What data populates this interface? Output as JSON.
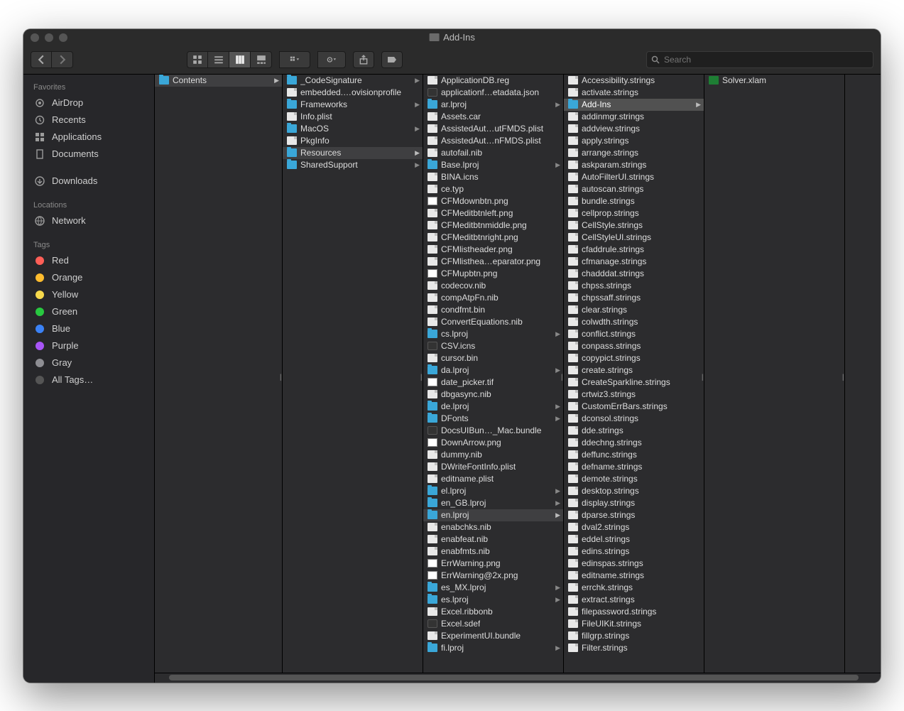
{
  "window": {
    "title": "Add-Ins"
  },
  "search": {
    "placeholder": "Search"
  },
  "sidebar": {
    "sections": [
      {
        "title": "Favorites",
        "items": [
          {
            "icon": "airdrop",
            "label": "AirDrop"
          },
          {
            "icon": "recents",
            "label": "Recents"
          },
          {
            "icon": "apps",
            "label": "Applications"
          },
          {
            "icon": "docs",
            "label": "Documents"
          },
          {
            "icon": "downloads",
            "label": "Downloads"
          }
        ]
      },
      {
        "title": "Locations",
        "items": [
          {
            "icon": "network",
            "label": "Network"
          }
        ]
      },
      {
        "title": "Tags",
        "items": [
          {
            "tag": "#ff5f57",
            "label": "Red"
          },
          {
            "tag": "#febc2e",
            "label": "Orange"
          },
          {
            "tag": "#f7d94c",
            "label": "Yellow"
          },
          {
            "tag": "#28c840",
            "label": "Green"
          },
          {
            "tag": "#3b82f6",
            "label": "Blue"
          },
          {
            "tag": "#a855f7",
            "label": "Purple"
          },
          {
            "tag": "#8e8e93",
            "label": "Gray"
          },
          {
            "tag": "#555",
            "label": "All Tags…"
          }
        ]
      }
    ]
  },
  "columns": [
    [
      {
        "t": "folder",
        "n": "Contents",
        "sel": true,
        "arrow": true
      }
    ],
    [
      {
        "t": "folder",
        "n": "_CodeSignature",
        "arrow": true
      },
      {
        "t": "file",
        "n": "embedded.…ovisionprofile"
      },
      {
        "t": "folder",
        "n": "Frameworks",
        "arrow": true
      },
      {
        "t": "file",
        "n": "Info.plist"
      },
      {
        "t": "folder",
        "n": "MacOS",
        "arrow": true
      },
      {
        "t": "file",
        "n": "PkgInfo"
      },
      {
        "t": "folder",
        "n": "Resources",
        "sel": true,
        "arrow": true
      },
      {
        "t": "folder",
        "n": "SharedSupport",
        "arrow": true
      }
    ],
    [
      {
        "t": "file",
        "n": "ApplicationDB.reg"
      },
      {
        "t": "app",
        "n": "applicationf…etadata.json"
      },
      {
        "t": "folder",
        "n": "ar.lproj",
        "arrow": true
      },
      {
        "t": "file",
        "n": "Assets.car"
      },
      {
        "t": "file",
        "n": "AssistedAut…utFMDS.plist"
      },
      {
        "t": "file",
        "n": "AssistedAut…nFMDS.plist"
      },
      {
        "t": "file",
        "n": "autofail.nib"
      },
      {
        "t": "folder",
        "n": "Base.lproj",
        "arrow": true
      },
      {
        "t": "file",
        "n": "BINA.icns"
      },
      {
        "t": "file",
        "n": "ce.typ"
      },
      {
        "t": "img",
        "n": "CFMdownbtn.png"
      },
      {
        "t": "file",
        "n": "CFMeditbtnleft.png"
      },
      {
        "t": "file",
        "n": "CFMeditbtnmiddle.png"
      },
      {
        "t": "file",
        "n": "CFMeditbtnright.png"
      },
      {
        "t": "file",
        "n": "CFMlistheader.png"
      },
      {
        "t": "file",
        "n": "CFMlisthea…eparator.png"
      },
      {
        "t": "img",
        "n": "CFMupbtn.png"
      },
      {
        "t": "file",
        "n": "codecov.nib"
      },
      {
        "t": "file",
        "n": "compAtpFn.nib"
      },
      {
        "t": "file",
        "n": "condfmt.bin"
      },
      {
        "t": "file",
        "n": "ConvertEquations.nib"
      },
      {
        "t": "folder",
        "n": "cs.lproj",
        "arrow": true
      },
      {
        "t": "app",
        "n": "CSV.icns"
      },
      {
        "t": "file",
        "n": "cursor.bin"
      },
      {
        "t": "folder",
        "n": "da.lproj",
        "arrow": true
      },
      {
        "t": "img",
        "n": "date_picker.tif"
      },
      {
        "t": "file",
        "n": "dbgasync.nib"
      },
      {
        "t": "folder",
        "n": "de.lproj",
        "arrow": true
      },
      {
        "t": "folder",
        "n": "DFonts",
        "arrow": true
      },
      {
        "t": "app",
        "n": "DocsUIBun…_Mac.bundle"
      },
      {
        "t": "img",
        "n": "DownArrow.png"
      },
      {
        "t": "file",
        "n": "dummy.nib"
      },
      {
        "t": "file",
        "n": "DWriteFontInfo.plist"
      },
      {
        "t": "file",
        "n": "editname.plist"
      },
      {
        "t": "folder",
        "n": "el.lproj",
        "arrow": true
      },
      {
        "t": "folder",
        "n": "en_GB.lproj",
        "arrow": true
      },
      {
        "t": "folder",
        "n": "en.lproj",
        "sel": true,
        "arrow": true
      },
      {
        "t": "file",
        "n": "enabchks.nib"
      },
      {
        "t": "file",
        "n": "enabfeat.nib"
      },
      {
        "t": "file",
        "n": "enabfmts.nib"
      },
      {
        "t": "img",
        "n": "ErrWarning.png"
      },
      {
        "t": "img",
        "n": "ErrWarning@2x.png"
      },
      {
        "t": "folder",
        "n": "es_MX.lproj",
        "arrow": true
      },
      {
        "t": "folder",
        "n": "es.lproj",
        "arrow": true
      },
      {
        "t": "file",
        "n": "Excel.ribbonb"
      },
      {
        "t": "app",
        "n": "Excel.sdef"
      },
      {
        "t": "file",
        "n": "ExperimentUI.bundle"
      },
      {
        "t": "folder",
        "n": "fi.lproj",
        "arrow": true
      }
    ],
    [
      {
        "t": "file",
        "n": "Accessibility.strings"
      },
      {
        "t": "file",
        "n": "activate.strings"
      },
      {
        "t": "folder",
        "n": "Add-Ins",
        "sel": true,
        "arrow": true
      },
      {
        "t": "file",
        "n": "addinmgr.strings"
      },
      {
        "t": "file",
        "n": "addview.strings"
      },
      {
        "t": "file",
        "n": "apply.strings"
      },
      {
        "t": "file",
        "n": "arrange.strings"
      },
      {
        "t": "file",
        "n": "askparam.strings"
      },
      {
        "t": "file",
        "n": "AutoFilterUI.strings"
      },
      {
        "t": "file",
        "n": "autoscan.strings"
      },
      {
        "t": "file",
        "n": "bundle.strings"
      },
      {
        "t": "file",
        "n": "cellprop.strings"
      },
      {
        "t": "file",
        "n": "CellStyle.strings"
      },
      {
        "t": "file",
        "n": "CellStyleUI.strings"
      },
      {
        "t": "file",
        "n": "cfaddrule.strings"
      },
      {
        "t": "file",
        "n": "cfmanage.strings"
      },
      {
        "t": "file",
        "n": "chadddat.strings"
      },
      {
        "t": "file",
        "n": "chpss.strings"
      },
      {
        "t": "file",
        "n": "chpssaff.strings"
      },
      {
        "t": "file",
        "n": "clear.strings"
      },
      {
        "t": "file",
        "n": "colwdth.strings"
      },
      {
        "t": "file",
        "n": "conflict.strings"
      },
      {
        "t": "file",
        "n": "conpass.strings"
      },
      {
        "t": "file",
        "n": "copypict.strings"
      },
      {
        "t": "file",
        "n": "create.strings"
      },
      {
        "t": "file",
        "n": "CreateSparkline.strings"
      },
      {
        "t": "file",
        "n": "crtwiz3.strings"
      },
      {
        "t": "file",
        "n": "CustomErrBars.strings"
      },
      {
        "t": "file",
        "n": "dconsol.strings"
      },
      {
        "t": "file",
        "n": "dde.strings"
      },
      {
        "t": "file",
        "n": "ddechng.strings"
      },
      {
        "t": "file",
        "n": "deffunc.strings"
      },
      {
        "t": "file",
        "n": "defname.strings"
      },
      {
        "t": "file",
        "n": "demote.strings"
      },
      {
        "t": "file",
        "n": "desktop.strings"
      },
      {
        "t": "file",
        "n": "display.strings"
      },
      {
        "t": "file",
        "n": "dparse.strings"
      },
      {
        "t": "file",
        "n": "dval2.strings"
      },
      {
        "t": "file",
        "n": "eddel.strings"
      },
      {
        "t": "file",
        "n": "edins.strings"
      },
      {
        "t": "file",
        "n": "edinspas.strings"
      },
      {
        "t": "file",
        "n": "editname.strings"
      },
      {
        "t": "file",
        "n": "errchk.strings"
      },
      {
        "t": "file",
        "n": "extract.strings"
      },
      {
        "t": "file",
        "n": "filepassword.strings"
      },
      {
        "t": "file",
        "n": "FileUIKit.strings"
      },
      {
        "t": "file",
        "n": "fillgrp.strings"
      },
      {
        "t": "file",
        "n": "Filter.strings"
      }
    ],
    [
      {
        "t": "xls",
        "n": "Solver.xlam"
      }
    ]
  ]
}
